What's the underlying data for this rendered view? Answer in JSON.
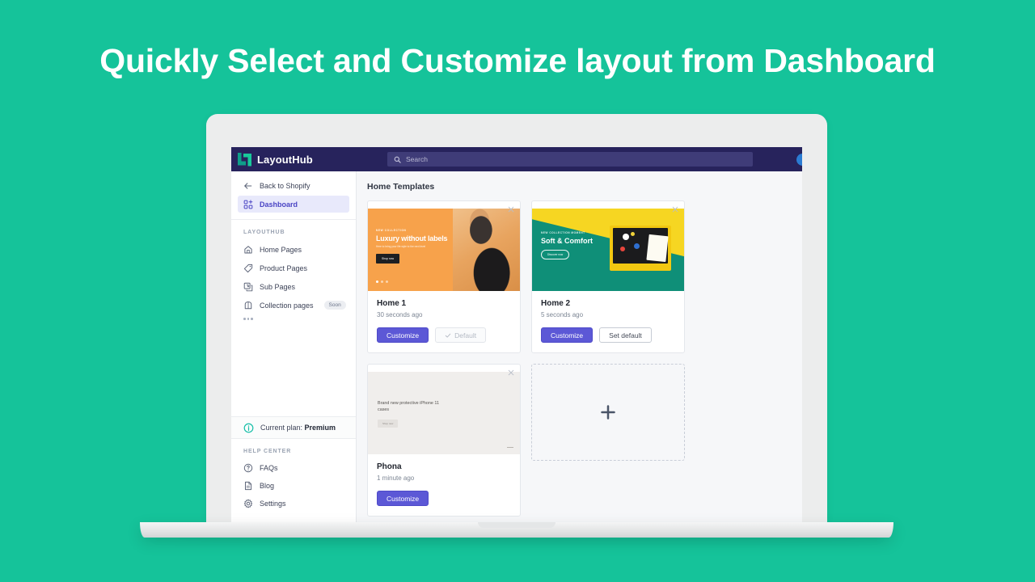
{
  "headline": "Quickly Select and Customize layout from Dashboard",
  "theme": {
    "background": "#15c39a",
    "header_bg": "#27235c",
    "accent_purple": "#5c58d6",
    "logo_dark": "#0f9e8a",
    "logo_light": "#18c99a"
  },
  "app": {
    "brand_name": "LayoutHub",
    "search": {
      "placeholder": "Search",
      "value": "",
      "icon": "search-icon"
    },
    "avatar": "user-avatar"
  },
  "sidebar": {
    "top_items": [
      {
        "label": "Back to Shopify",
        "icon": "arrow-left-icon",
        "active": false
      },
      {
        "label": "Dashboard",
        "icon": "dashboard-grid-icon",
        "active": true
      }
    ],
    "section_label": "LAYOUTHUB",
    "items": [
      {
        "label": "Home Pages",
        "icon": "home-icon",
        "badge": ""
      },
      {
        "label": "Product Pages",
        "icon": "tag-icon",
        "badge": ""
      },
      {
        "label": "Sub Pages",
        "icon": "sub-page-icon",
        "badge": ""
      },
      {
        "label": "Collection pages",
        "icon": "collection-icon",
        "badge": "Soon"
      }
    ],
    "more_icon": "more-dots-icon",
    "plan": {
      "icon": "info-icon",
      "label": "Current plan:",
      "value": "Premium"
    },
    "help_section_label": "HELP CENTER",
    "help_items": [
      {
        "label": "FAQs",
        "icon": "question-circle-icon"
      },
      {
        "label": "Blog",
        "icon": "document-icon"
      },
      {
        "label": "Settings",
        "icon": "gear-icon"
      }
    ]
  },
  "main": {
    "title": "Home Templates",
    "cards": [
      {
        "name": "Home 1",
        "time": "30 seconds ago",
        "close_icon": "close-icon",
        "primary_button": "Customize",
        "secondary_button": "Default",
        "secondary_state": "disabled",
        "secondary_icon": "check-icon",
        "thumb": {
          "eyebrow": "NEW COLLECTION",
          "heading": "Luxury without labels",
          "sub": "Here to bring your life style to the next level",
          "button": "Shop now"
        }
      },
      {
        "name": "Home 2",
        "time": "5 seconds ago",
        "close_icon": "close-icon",
        "primary_button": "Customize",
        "secondary_button": "Set default",
        "secondary_state": "enabled",
        "secondary_icon": "",
        "thumb": {
          "eyebrow": "NEW COLLECTION MOMENT",
          "heading": "Soft & Comfort",
          "sub": "",
          "button": "Discover now"
        }
      },
      {
        "name": "Phona",
        "time": "1 minute ago",
        "close_icon": "close-icon",
        "primary_button": "Customize",
        "secondary_button": "",
        "secondary_state": "hidden",
        "secondary_icon": "",
        "thumb": {
          "eyebrow": "",
          "heading": "Brand new protective iPhone 11 cases",
          "sub": "",
          "button": "Shop now"
        }
      }
    ],
    "add_card": {
      "icon": "plus-icon",
      "label": ""
    }
  }
}
